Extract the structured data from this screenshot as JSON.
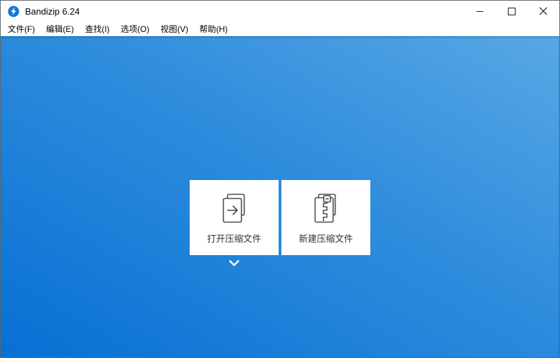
{
  "window": {
    "title": "Bandizip 6.24",
    "controls": {
      "minimize": "minimize",
      "maximize": "maximize",
      "close": "close"
    }
  },
  "menubar": {
    "items": [
      "文件(F)",
      "编辑(E)",
      "查找(I)",
      "选项(O)",
      "视图(V)",
      "帮助(H)"
    ]
  },
  "workspace": {
    "open_archive": {
      "label": "打开压缩文件",
      "icon": "open-archive-icon"
    },
    "new_archive": {
      "label": "新建压缩文件",
      "icon": "new-archive-icon"
    },
    "expander_icon": "chevron-down-icon"
  },
  "colors": {
    "gradient_top_right": "#58a8e4",
    "gradient_bottom_left": "#0770d4",
    "logo_blue": "#1377d4",
    "tile_background": "#ffffff",
    "tile_text": "#333333",
    "icon_stroke": "#4a4a4a",
    "chevron": "#ffffff"
  }
}
